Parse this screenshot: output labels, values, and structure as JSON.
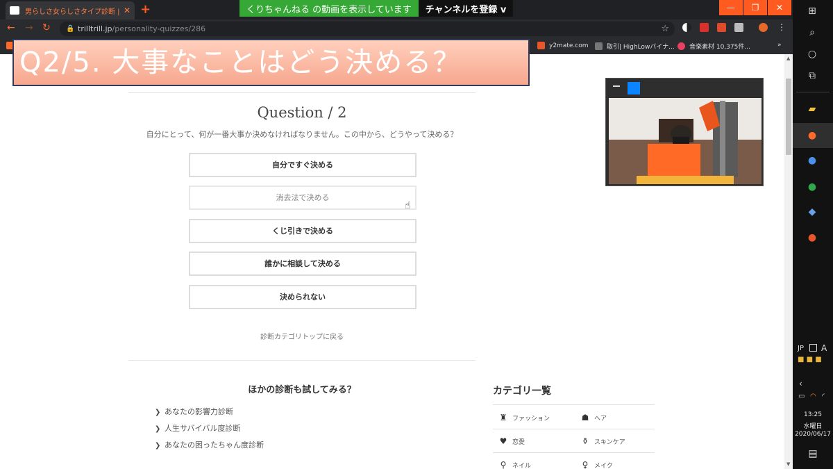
{
  "browser": {
    "tab_title": "男らしさ女らしさタイプ診断 | TRILL【ト",
    "tab_close": "✕",
    "new_tab": "+",
    "url_host": "trilltrill.jp",
    "url_path": "/personality-quizzes/286"
  },
  "overlay_banner": {
    "green_text": "くりちゃんねる の動画を表示しています",
    "subscribe_text": "チャンネルを登録 v"
  },
  "bookmarks": [
    {
      "label": "y2mate.com",
      "color": "#e8562a"
    },
    {
      "label": "取引| HighLowバイナ...",
      "color": "#777777"
    },
    {
      "label": "音楽素材 10,375件...",
      "color": "#e84060"
    }
  ],
  "quiz_banner": "Q2/5. 大事なことはどう決める？",
  "quiz": {
    "title": "Question / 2",
    "description": "自分にとって、何が一番大事か決めなければなりません。この中から、どうやって決める？",
    "answers": [
      "自分ですぐ決める",
      "消去法で決める",
      "くじ引きで決める",
      "誰かに相談して決める",
      "決められない"
    ],
    "back_link": "診断カテゴリトップに戻る"
  },
  "other_quizzes": {
    "title": "ほかの診断も試してみる？",
    "items": [
      "あなたの影響力診断",
      "人生サバイバル度診断",
      "あなたの困ったちゃん度診断"
    ]
  },
  "categories": {
    "title": "カテゴリ一覧",
    "items": [
      {
        "label": "ファッション",
        "icon": "dress-icon"
      },
      {
        "label": "ヘア",
        "icon": "hair-icon"
      },
      {
        "label": "恋愛",
        "icon": "heart-icon"
      },
      {
        "label": "スキンケア",
        "icon": "bottle-icon"
      },
      {
        "label": "ネイル",
        "icon": "nail-polish-icon"
      },
      {
        "label": "メイク",
        "icon": "makeup-icon"
      }
    ]
  },
  "taskbar": {
    "lang": "JP",
    "ime": "A",
    "time": "13:25",
    "weekday": "水曜日",
    "date": "2020/06/17"
  },
  "colors": {
    "accent": "#ff5a1f",
    "banner_green": "#36a836",
    "webcam_badge": "#0a84ff"
  }
}
